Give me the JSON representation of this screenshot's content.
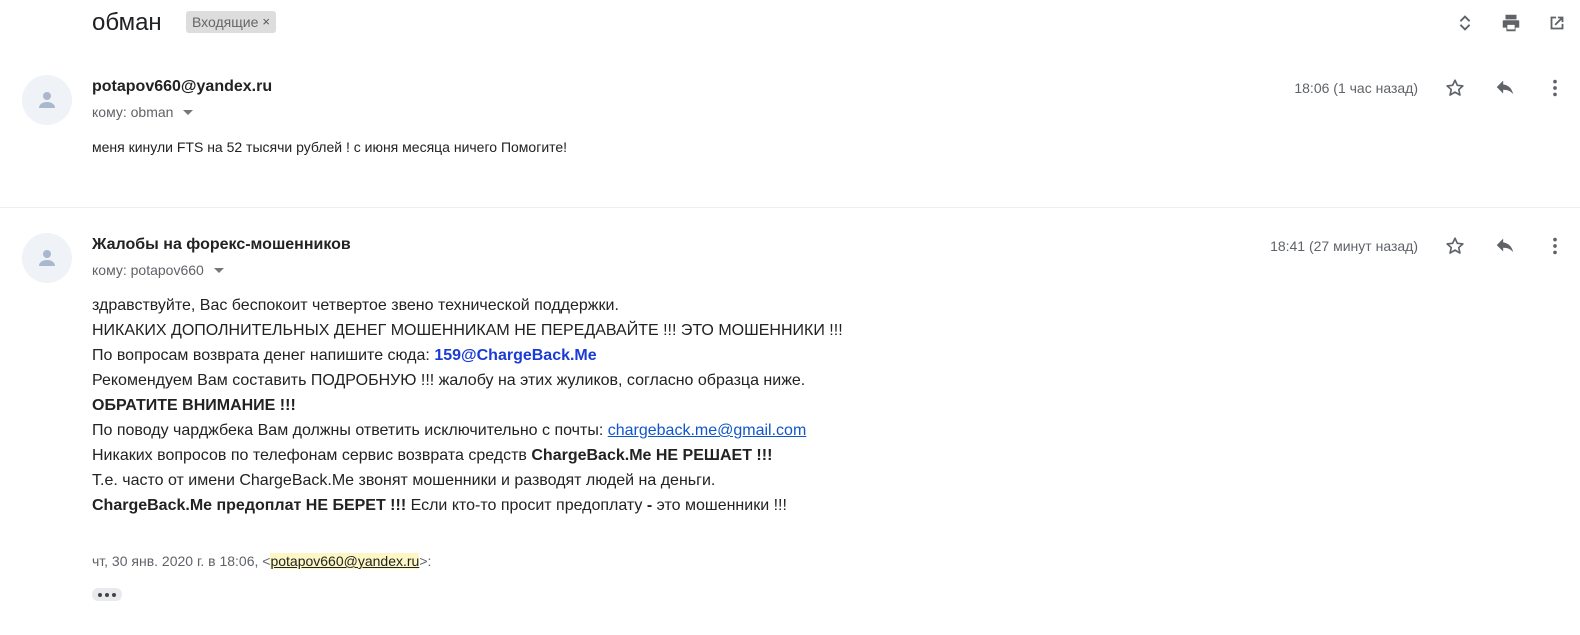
{
  "subject": {
    "title": "обман",
    "label": "Входящие",
    "label_remove": "×"
  },
  "toolbar": {
    "icons": [
      "expand-collapse-icon",
      "print-icon",
      "open-new-window-icon"
    ]
  },
  "messages": [
    {
      "sender": "potapov660@yandex.ru",
      "recipient": "кому: obman",
      "timestamp": "18:06 (1 час назад)",
      "body": "меня кинули FTS на 52 тысячи рублей ! с июня месяца ничего Помогите!"
    },
    {
      "sender": "Жалобы на форекс-мошенников",
      "recipient": "кому: potapov660",
      "timestamp": "18:41 (27 минут назад)",
      "body": {
        "line1": "здравствуйте, Вас беспокоит четвертое звено технической поддержки.",
        "line2": "НИКАКИХ ДОПОЛНИТЕЛЬНЫХ ДЕНЕГ МОШЕННИКАМ НЕ ПЕРЕДАВАЙТЕ !!! ЭТО МОШЕННИКИ !!!",
        "line3_prefix": "По вопросам возврата денег напишите сюда: ",
        "line3_link": "159@ChargeBack.Me",
        "line4": "Рекомендуем Вам составить ПОДРОБНУЮ !!! жалобу на этих жуликов, согласно образца ниже.",
        "line5": "ОБРАТИТЕ ВНИМАНИЕ !!!",
        "line6_prefix": "По поводу чарджбека Вам должны ответить исключительно с почты: ",
        "line6_link": "chargeback.me@gmail.com",
        "line7_prefix": "Никаких вопросов по телефонам сервис возврата средств ",
        "line7_bold": "ChargeBack.Me НЕ РЕШАЕТ !!!",
        "line8": "Т.е. часто от имени ChargeBack.Me звонят мошенники и разводят людей на деньги.",
        "line9_bold": "ChargeBack.Me предоплат НЕ БЕРЕТ !!!",
        "line9_mid": " Если кто-то просит предоплату ",
        "line9_dash": "-",
        "line9_suffix": " это мошенники !!!"
      },
      "quote": {
        "prefix": "чт, 30 янв. 2020 г. в 18:06, <",
        "email": "potapov660@yandex.ru",
        "suffix": ">:"
      }
    }
  ],
  "colors": {
    "accent_link": "#1a3bd6",
    "gmail_link": "#1155cc",
    "highlight": "#fdf7c6"
  }
}
